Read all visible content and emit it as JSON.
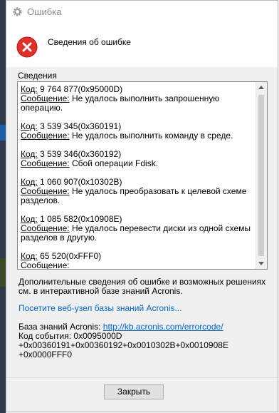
{
  "window": {
    "title": "Ошибка",
    "icon": "gear-icon"
  },
  "header": {
    "icon": "error-x-icon",
    "text": "Сведения об ошибке",
    "accent_color": "#e81123"
  },
  "details": {
    "label": "Сведения",
    "entries": [
      {
        "code_label": "Код:",
        "code": "9 764 877(0x95000D)",
        "message_label": "Сообщение:",
        "message": "Не удалось выполнить запрошенную операцию."
      },
      {
        "code_label": "Код:",
        "code": "3 539 345(0x360191)",
        "message_label": "Сообщение:",
        "message": "Не удалось выполнить команду в среде."
      },
      {
        "code_label": "Код:",
        "code": "3 539 346(0x360192)",
        "message_label": "Сообщение:",
        "message": "Сбой операции Fdisk."
      },
      {
        "code_label": "Код:",
        "code": "1 060 907(0x10302B)",
        "message_label": "Сообщение:",
        "message": "Не удалось преобразовать к целевой схеме разделов."
      },
      {
        "code_label": "Код:",
        "code": "1 085 582(0x10908E)",
        "message_label": "Сообщение:",
        "message": "Не удалось перевести диски из одной схемы разделов в другую."
      },
      {
        "code_label": "Код:",
        "code": "65 520(0xFFF0)",
        "message_label": "Сообщение:",
        "message": ""
      }
    ]
  },
  "info_text": "Дополнительные сведения об ошибке и возможных решениях см. в интерактивной базе знаний Acronis.",
  "site_link": "Посетите веб-узел базы знаний Acronis...",
  "kb": {
    "label": "База знаний Acronis:",
    "url": "http://kb.acronis.com/errorcode/",
    "event_line1": "Код события: 0x0095000D",
    "event_line2": "+0x00360191+0x00360192+0x0010302B+0x0010908E",
    "event_line3": "+0x0000FFF0"
  },
  "footer": {
    "close_label": "Закрыть"
  }
}
